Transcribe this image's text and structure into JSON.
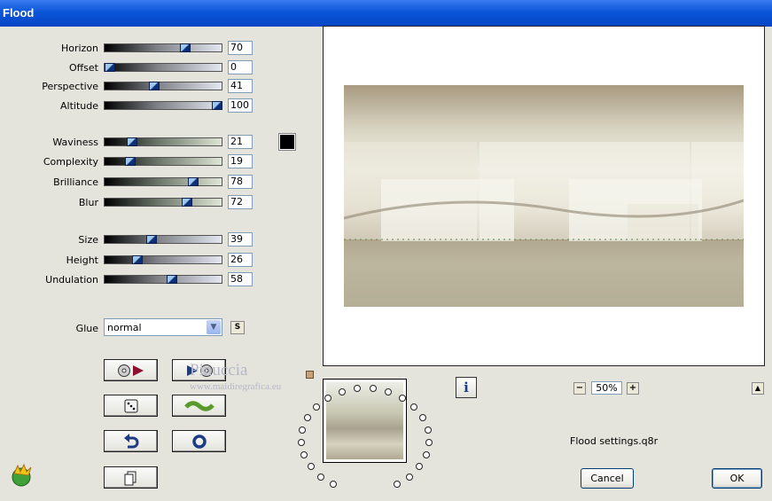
{
  "window": {
    "title": "Flood"
  },
  "sliders": [
    {
      "label": "Horizon",
      "value": "70",
      "style": "blue"
    },
    {
      "label": "Offset",
      "value": "0",
      "style": "blue"
    },
    {
      "label": "Perspective",
      "value": "41",
      "style": "blue"
    },
    {
      "label": "Altitude",
      "value": "100",
      "style": "blue"
    },
    {
      "label": "Waviness",
      "value": "21",
      "style": "green"
    },
    {
      "label": "Complexity",
      "value": "19",
      "style": "green"
    },
    {
      "label": "Brilliance",
      "value": "78",
      "style": "green"
    },
    {
      "label": "Blur",
      "value": "72",
      "style": "green"
    },
    {
      "label": "Size",
      "value": "39",
      "style": "blue"
    },
    {
      "label": "Height",
      "value": "26",
      "style": "blue"
    },
    {
      "label": "Undulation",
      "value": "58",
      "style": "blue"
    }
  ],
  "color_swatch": "#000000",
  "glue": {
    "label": "Glue",
    "value": "normal",
    "s_label": "S"
  },
  "watermark": {
    "name": "Pinuccia",
    "url": "www.maidiregrafica.eu"
  },
  "zoom": {
    "value": "50%",
    "minus": "−",
    "plus": "+"
  },
  "info_label": "i",
  "settings_file": "Flood settings.q8r",
  "buttons": {
    "cancel": "Cancel",
    "ok": "OK"
  },
  "accent": "#0a55d8"
}
